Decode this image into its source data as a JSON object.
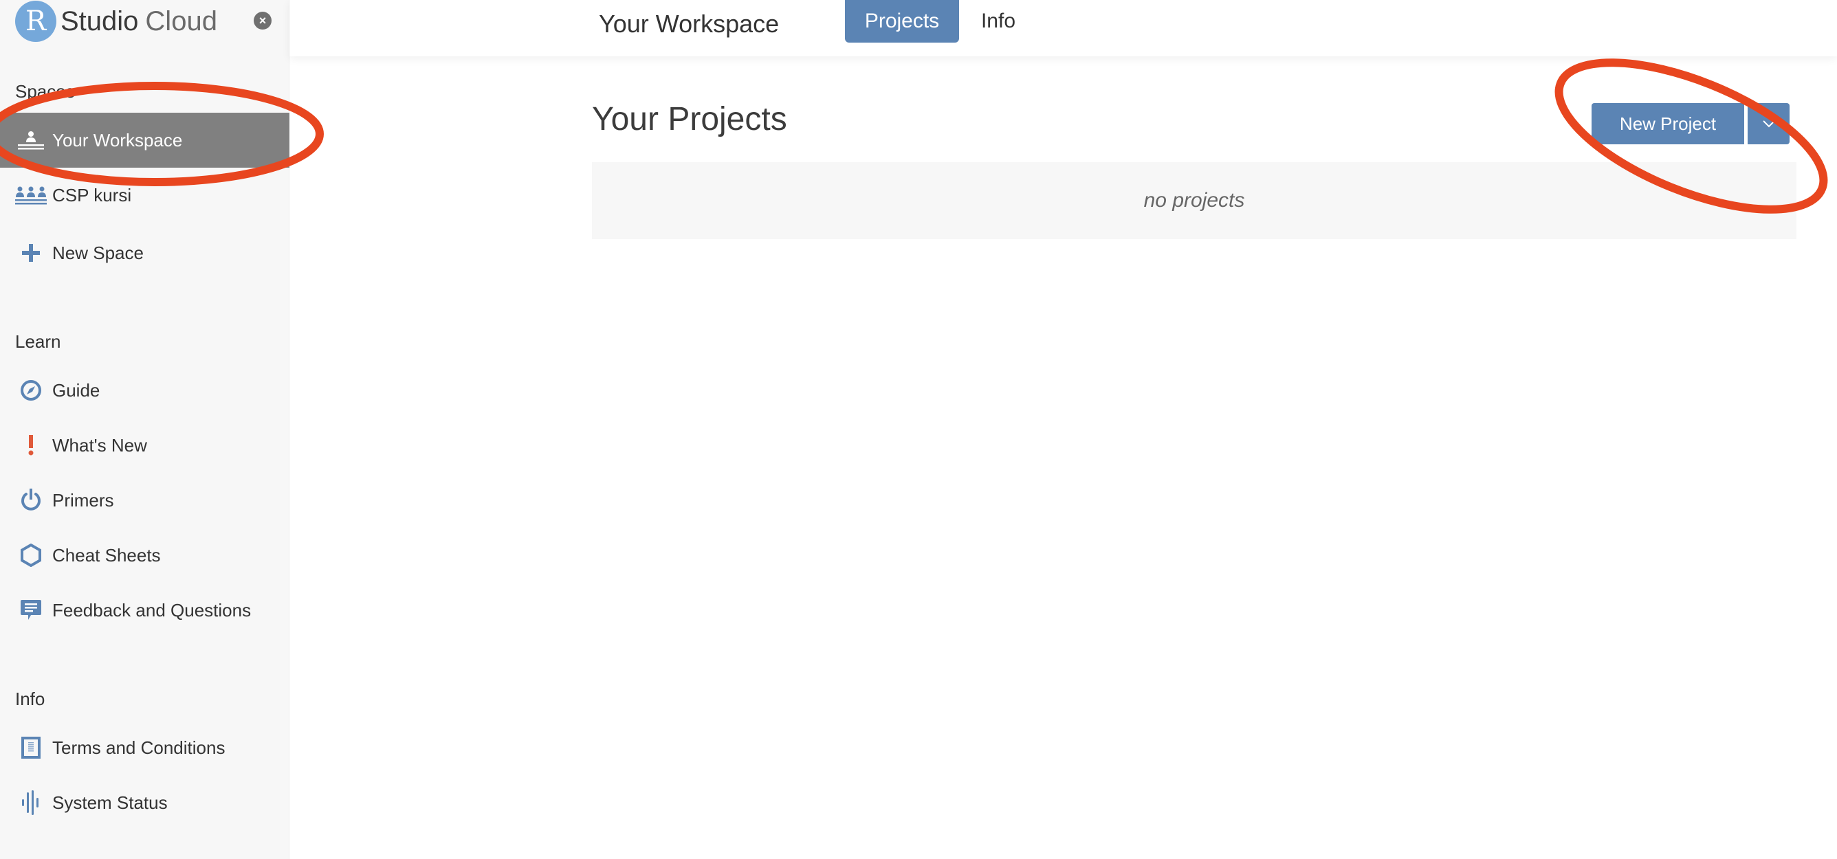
{
  "brand": {
    "logo_letter": "R",
    "name_bold": "Studio",
    "name_light": "Cloud"
  },
  "sidebar": {
    "close_icon": "close-icon",
    "sections": {
      "spaces": "Spaces",
      "learn": "Learn",
      "info": "Info"
    },
    "spaces_items": [
      {
        "label": "Your Workspace",
        "icon": "person-desk-icon",
        "active": true
      },
      {
        "label": "CSP kursi",
        "icon": "group-icon",
        "active": false
      },
      {
        "label": "New Space",
        "icon": "plus-icon",
        "active": false
      }
    ],
    "learn_items": [
      {
        "label": "Guide",
        "icon": "compass-icon"
      },
      {
        "label": "What's New",
        "icon": "exclamation-icon"
      },
      {
        "label": "Primers",
        "icon": "power-icon"
      },
      {
        "label": "Cheat Sheets",
        "icon": "hexagon-icon"
      },
      {
        "label": "Feedback and Questions",
        "icon": "chat-bubble-icon"
      }
    ],
    "info_items": [
      {
        "label": "Terms and Conditions",
        "icon": "document-icon"
      },
      {
        "label": "System Status",
        "icon": "pulse-icon"
      }
    ]
  },
  "header": {
    "title": "Your Workspace",
    "tabs": [
      {
        "label": "Projects",
        "active": true
      },
      {
        "label": "Info",
        "active": false
      }
    ]
  },
  "main": {
    "title": "Your Projects",
    "new_project_label": "New Project",
    "empty_text": "no projects"
  },
  "colors": {
    "accent": "#5b84b4",
    "logo": "#75a8da",
    "active_item_bg": "#808080",
    "whats_new_icon": "#e05a3a",
    "annotation": "#e8461f"
  }
}
